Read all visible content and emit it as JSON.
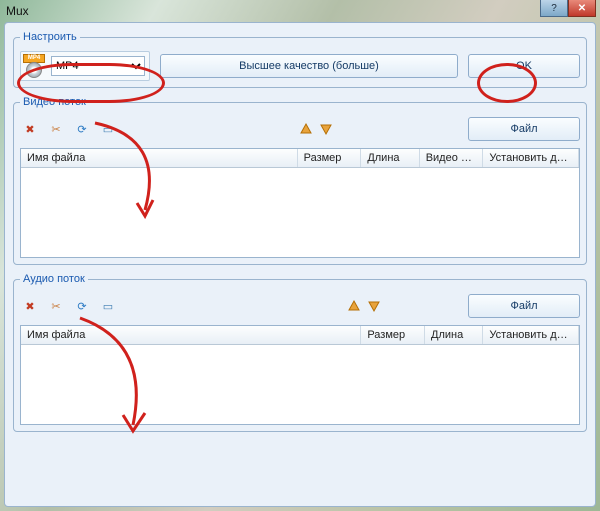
{
  "window": {
    "title": "Mux"
  },
  "configure": {
    "legend": "Настроить",
    "format_selected": "MP4",
    "format_badge": "MP4",
    "quality_button": "Высшее качество (больше)",
    "ok_button": "OK"
  },
  "video": {
    "legend": "Видео поток",
    "file_button": "Файл",
    "columns": {
      "name": "Имя файла",
      "size": "Размер",
      "length": "Длина",
      "video_ext": "Видео ра...",
      "set_range": "Установить диа..."
    }
  },
  "audio": {
    "legend": "Аудио поток",
    "file_button": "Файл",
    "columns": {
      "name": "Имя файла",
      "size": "Размер",
      "length": "Длина",
      "set_range": "Установить диа..."
    }
  },
  "icons": {
    "delete": "✖",
    "cut": "✂",
    "refresh": "⟳",
    "preview": "▭",
    "up": "▲",
    "down": "▼"
  },
  "colors": {
    "icon_delete": "#c23b22",
    "icon_cut": "#c87a3a",
    "icon_refresh": "#2d7bc4",
    "icon_preview": "#3a7ab0",
    "arrow_fill": "#e8a33c",
    "arrow_stroke": "#b56f05"
  }
}
